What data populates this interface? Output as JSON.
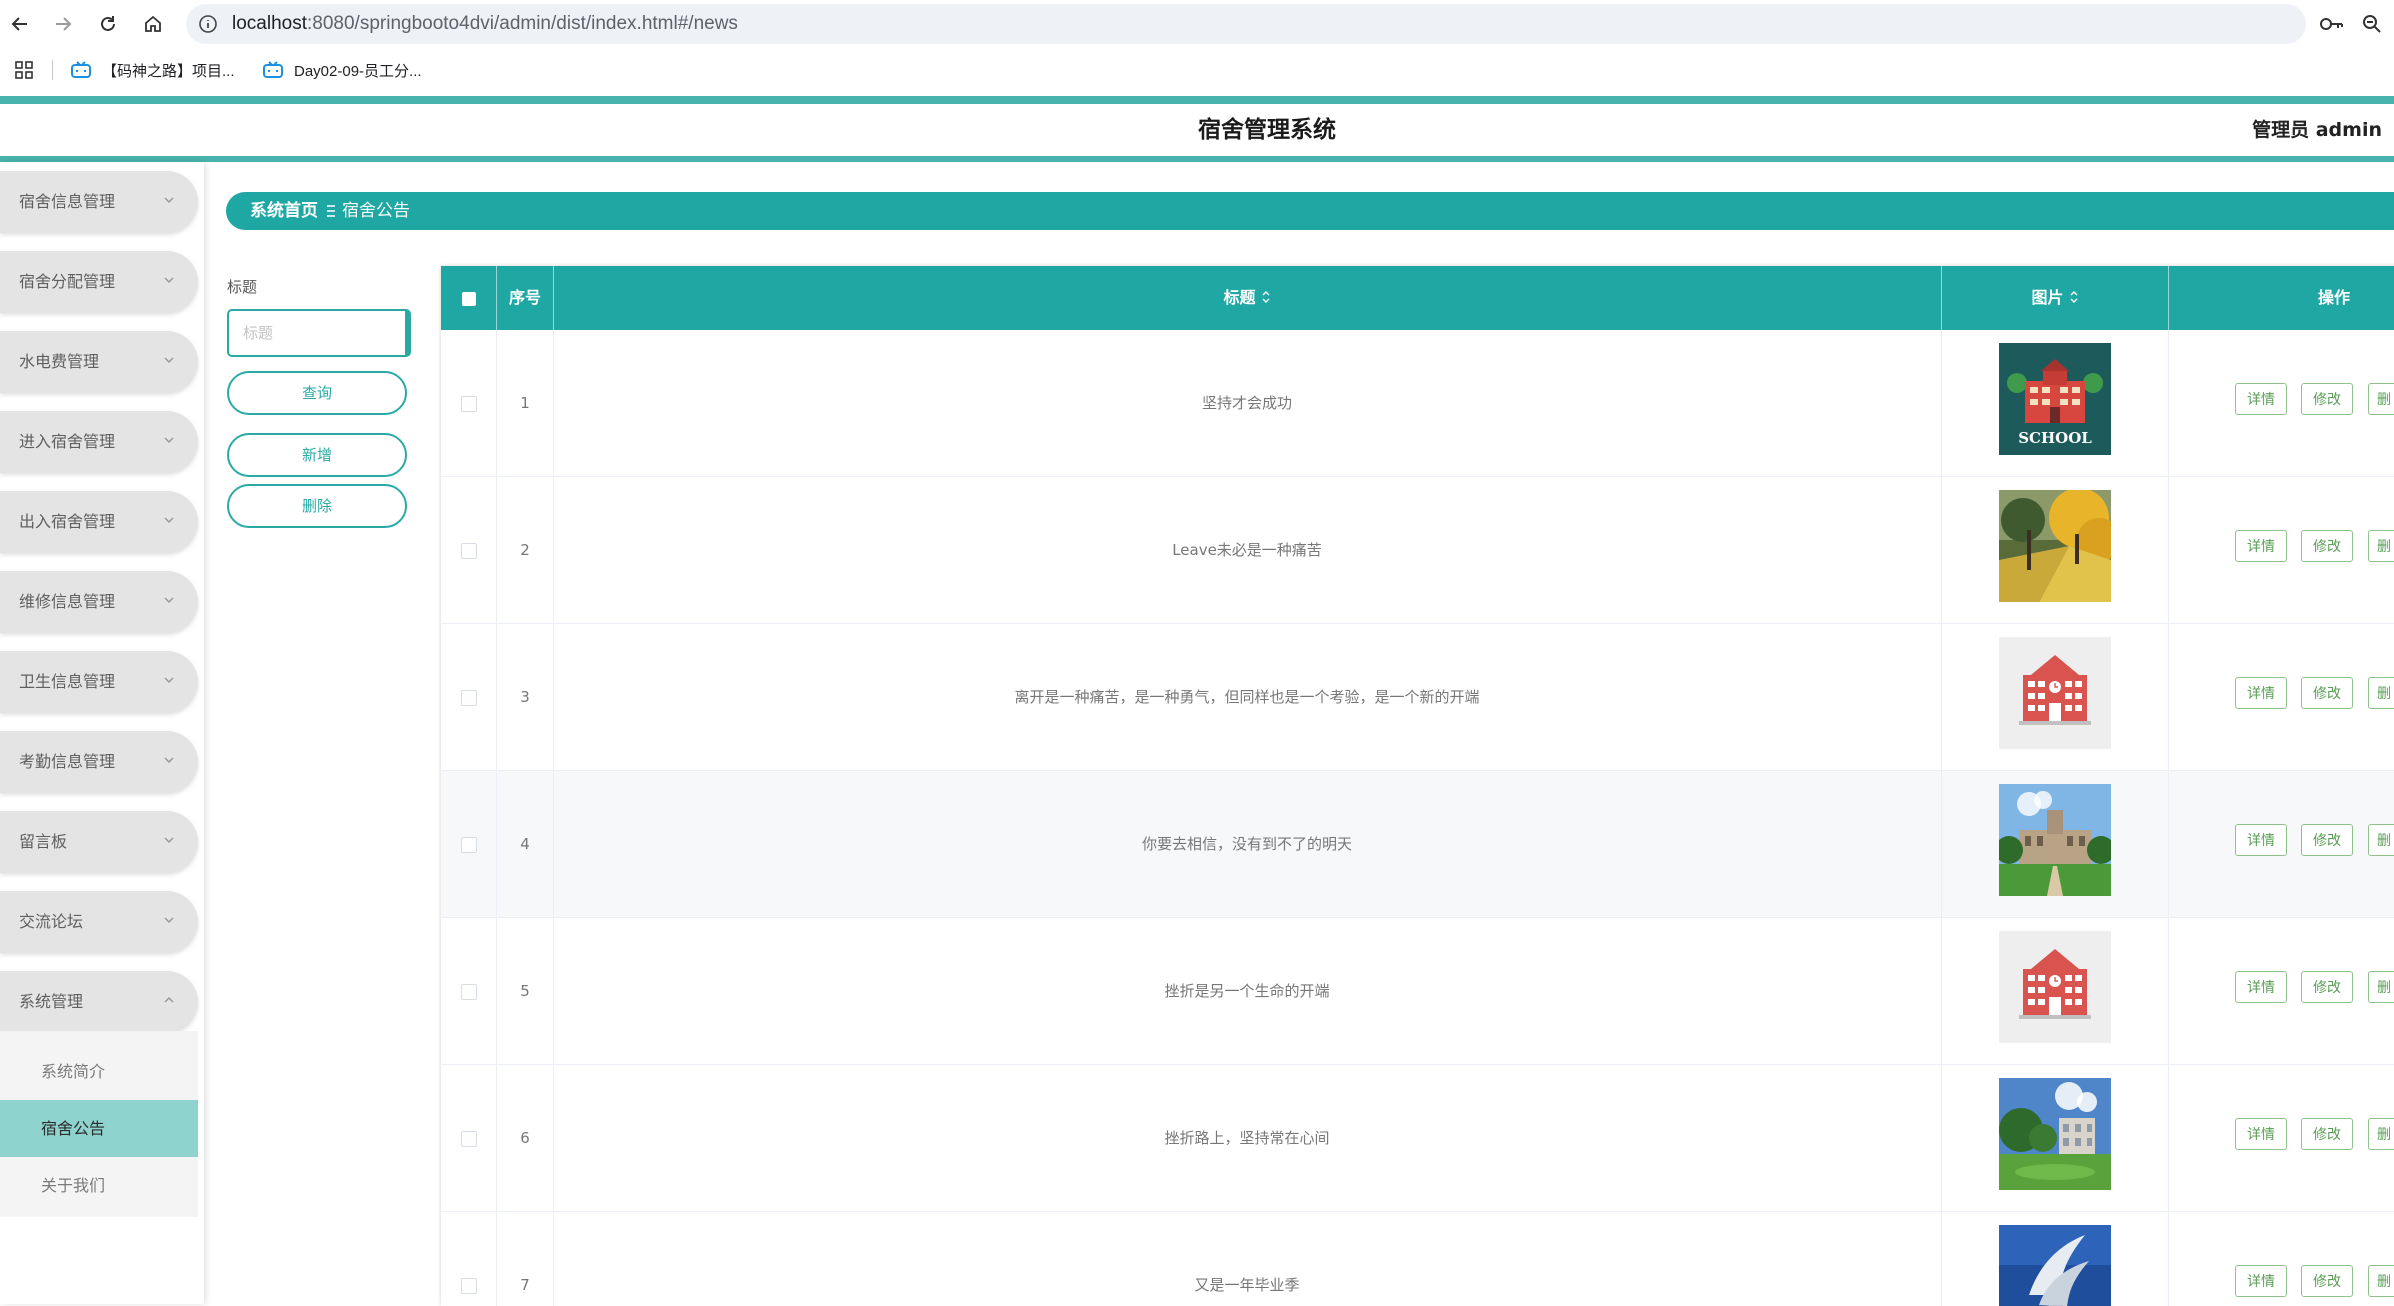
{
  "browser": {
    "url_host": "localhost",
    "url_rest": ":8080/springbooto4dvi/admin/dist/index.html#/news",
    "bookmarks": [
      {
        "label": "【码神之路】项目..."
      },
      {
        "label": "Day02-09-员工分..."
      }
    ]
  },
  "app": {
    "title": "宿舍管理系统",
    "user_label": "管理员 admin"
  },
  "sidebar": {
    "menus": [
      {
        "label": "宿舍信息管理"
      },
      {
        "label": "宿舍分配管理"
      },
      {
        "label": "水电费管理"
      },
      {
        "label": "进入宿舍管理"
      },
      {
        "label": "出入宿舍管理"
      },
      {
        "label": "维修信息管理"
      },
      {
        "label": "卫生信息管理"
      },
      {
        "label": "考勤信息管理"
      },
      {
        "label": "留言板"
      },
      {
        "label": "交流论坛"
      },
      {
        "label": "系统管理"
      }
    ],
    "submenu": [
      {
        "label": "系统简介",
        "active": false
      },
      {
        "label": "宿舍公告",
        "active": true
      },
      {
        "label": "关于我们",
        "active": false
      }
    ]
  },
  "breadcrumb": {
    "home": "系统首页",
    "current": "宿舍公告"
  },
  "filter": {
    "title_label": "标题",
    "title_placeholder": "标题",
    "query_label": "查询",
    "add_label": "新增",
    "delete_label": "删除"
  },
  "table": {
    "headers": {
      "index": "序号",
      "title": "标题",
      "image": "图片",
      "actions": "操作"
    },
    "action_labels": {
      "detail": "详情",
      "edit": "修改",
      "delete_partial": "删"
    },
    "rows": [
      {
        "index": "1",
        "title": "坚持才会成功",
        "image_icon": "back-to-school-image",
        "image_caption": "SCHOOL"
      },
      {
        "index": "2",
        "title": "Leave未必是一种痛苦",
        "image_icon": "autumn-path-image"
      },
      {
        "index": "3",
        "title": "离开是一种痛苦，是一种勇气，但同样也是一个考验，是一个新的开端",
        "image_icon": "school-building-icon-image"
      },
      {
        "index": "4",
        "title": "你要去相信，没有到不了的明天",
        "image_icon": "campus-building-image"
      },
      {
        "index": "5",
        "title": "挫折是另一个生命的开端",
        "image_icon": "school-building-icon-image"
      },
      {
        "index": "6",
        "title": "挫折路上，坚持常在心间",
        "image_icon": "campus-lawn-image"
      },
      {
        "index": "7",
        "title": "又是一年毕业季",
        "image_icon": "sculpture-sky-image"
      }
    ]
  },
  "colors": {
    "primary": "#1fa7a4",
    "header_bar": "#48b3ac",
    "active_submenu": "#8fd3cf",
    "action_button": "#5a9e55"
  }
}
